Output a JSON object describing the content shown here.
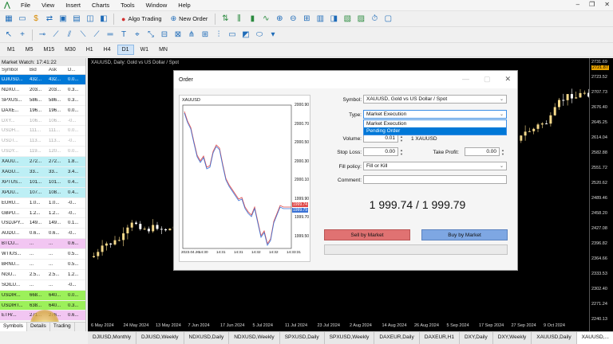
{
  "menu": {
    "items": [
      "File",
      "View",
      "Insert",
      "Charts",
      "Tools",
      "Window",
      "Help"
    ]
  },
  "toolbar": {
    "algo_trading": "Algo Trading",
    "new_order": "New Order"
  },
  "timeframes": {
    "items": [
      "M1",
      "M5",
      "M15",
      "M30",
      "H1",
      "H4",
      "D1",
      "W1",
      "MN"
    ],
    "active": "D1"
  },
  "market_watch": {
    "title": "Market Watch: 17:41:22",
    "headers": [
      "Symbol",
      "Bid",
      "Ask",
      "D..."
    ],
    "rows": [
      {
        "symbol": "DJIUSD...",
        "bid": "432...",
        "ask": "432...",
        "d": "0.0...",
        "style": "row-sel"
      },
      {
        "symbol": "NDXU...",
        "bid": "203...",
        "ask": "203...",
        "d": "0.3...",
        "style": ""
      },
      {
        "symbol": "SPXUS...",
        "bid": "586...",
        "ask": "586...",
        "d": "0.3...",
        "style": ""
      },
      {
        "symbol": "DAXE...",
        "bid": "196...",
        "ask": "196...",
        "d": "0.0...",
        "style": ""
      },
      {
        "symbol": "DXY...",
        "bid": "106...",
        "ask": "106...",
        "d": "-0...",
        "style": "row-grey"
      },
      {
        "symbol": "USDH...",
        "bid": "111...",
        "ask": "111...",
        "d": "0.0...",
        "style": "row-grey"
      },
      {
        "symbol": "USDT...",
        "bid": "113...",
        "ask": "113...",
        "d": "-0...",
        "style": "row-grey"
      },
      {
        "symbol": "USDY...",
        "bid": "119...",
        "ask": "120...",
        "d": "0.0...",
        "style": "row-grey"
      },
      {
        "symbol": "XAUU...",
        "bid": "272...",
        "ask": "272...",
        "d": "1.8...",
        "style": "row-cyan"
      },
      {
        "symbol": "XAGU...",
        "bid": "33...",
        "ask": "33...",
        "d": "3.4...",
        "style": "row-cyan"
      },
      {
        "symbol": "XPTUS...",
        "bid": "101...",
        "ask": "101...",
        "d": "0.4...",
        "style": "row-cyan"
      },
      {
        "symbol": "XPDU...",
        "bid": "107...",
        "ask": "108...",
        "d": "0.4...",
        "style": "row-cyan"
      },
      {
        "symbol": "EURU...",
        "bid": "1.0...",
        "ask": "1.0...",
        "d": "-0...",
        "style": ""
      },
      {
        "symbol": "GBPU...",
        "bid": "1.2...",
        "ask": "1.2...",
        "d": "-0...",
        "style": ""
      },
      {
        "symbol": "USDJPY...",
        "bid": "149...",
        "ask": "149...",
        "d": "0.1...",
        "style": ""
      },
      {
        "symbol": "AUDU...",
        "bid": "0.6...",
        "ask": "0.6...",
        "d": "-0...",
        "style": ""
      },
      {
        "symbol": "BTCU...",
        "bid": "...",
        "ask": "...",
        "d": "0.6...",
        "style": "row-mag"
      },
      {
        "symbol": "WTIUS...",
        "bid": "...",
        "ask": "...",
        "d": "0.5...",
        "style": ""
      },
      {
        "symbol": "BRNU...",
        "bid": "...",
        "ask": "...",
        "d": "0.5...",
        "style": ""
      },
      {
        "symbol": "NGU...",
        "bid": "2.5...",
        "ask": "2.5...",
        "d": "1.2...",
        "style": ""
      },
      {
        "symbol": "SOILU...",
        "bid": "...",
        "ask": "...",
        "d": "-0...",
        "style": ""
      },
      {
        "symbol": "USDIR...",
        "bid": "668...",
        "ask": "640...",
        "d": "0.0...",
        "style": "row-green"
      },
      {
        "symbol": "USDIRT...",
        "bid": "638...",
        "ask": "640...",
        "d": "0.3...",
        "style": "row-green"
      },
      {
        "symbol": "ETH/...",
        "bid": "271...",
        "ask": "276...",
        "d": "0.6...",
        "style": "row-mag"
      }
    ],
    "tabs": [
      "Symbols",
      "Details",
      "Trading"
    ]
  },
  "chart": {
    "title": "XAUUSD, Daily: Gold vs US Dollar / Spot",
    "price_labels": [
      "2731.69",
      "2723.52",
      "2707.73",
      "2676.40",
      "2645.25",
      "2614.04",
      "2582.88",
      "2551.72",
      "2520.62",
      "2489.46",
      "2458.20",
      "2427.08",
      "2396.82",
      "2364.66",
      "2333.53",
      "2302.40",
      "2271.24",
      "2240.13"
    ],
    "highlight_price": "2721.87",
    "date_labels": [
      "6 May 2024",
      "24 May 2024",
      "13 May 2024",
      "7 Jun 2024",
      "17 Jun 2024",
      "5 Jul 2024",
      "11 Jul 2024",
      "23 Jul 2024",
      "2 Aug 2024",
      "14 Aug 2024",
      "26 Aug 2024",
      "5 Sep 2024",
      "17 Sep 2024",
      "27 Sep 2024",
      "9 Oct 2024"
    ],
    "tabs": [
      "DJIUSD,Monthly",
      "DJIUSD,Weekly",
      "NDXUSD,Daily",
      "NDXUSD,Weekly",
      "SPXUSD,Daily",
      "SPXUSD,Weekly",
      "DAXEUR,Daily",
      "DAXEUR,H1",
      "DXY,Daily",
      "DXY,Weekly",
      "XAUUSD,Daily",
      "XAUUSD,..."
    ],
    "active_tab": "XAUUSD,..."
  },
  "order_dialog": {
    "title": "Order",
    "mini_chart": {
      "symbol": "XAUUSD",
      "y_labels": [
        "2000.90",
        "2000.70",
        "2000.50",
        "2000.30",
        "2000.10",
        "1999.90",
        "1999.70",
        "1999.50"
      ],
      "x_labels": [
        "2023.04.26",
        "14:30",
        "14:31",
        "14:31",
        "14:32",
        "14:32",
        "14:33:31"
      ],
      "bid_marker": "1999.74",
      "ask_marker": "1999.79"
    },
    "symbol_label": "Symbol:",
    "symbol_value": "XAUUSD, Gold vs US Dollar / Spot",
    "type_label": "Type:",
    "type_value": "Market Execution",
    "type_options": [
      "Market Execution",
      "Pending Order"
    ],
    "type_selected": "Pending Order",
    "volume_label": "Volume:",
    "volume_value": "0.01",
    "volume_unit": "1 XAUUSD",
    "stoploss_label": "Stop Loss:",
    "stoploss_value": "0.00",
    "takeprofit_label": "Take Profit:",
    "takeprofit_value": "0.00",
    "fill_policy_label": "Fill policy:",
    "fill_policy_value": "Fill or Kill",
    "comment_label": "Comment:",
    "price_display": "1 999.74 / 1 999.79",
    "sell_button": "Sell by Market",
    "buy_button": "Buy by Market"
  },
  "colors": {
    "sell": "#e07272",
    "buy": "#7ea7e3",
    "bull": "#f5d98a",
    "bear": "#ffffff",
    "accent": "#0078d7"
  }
}
